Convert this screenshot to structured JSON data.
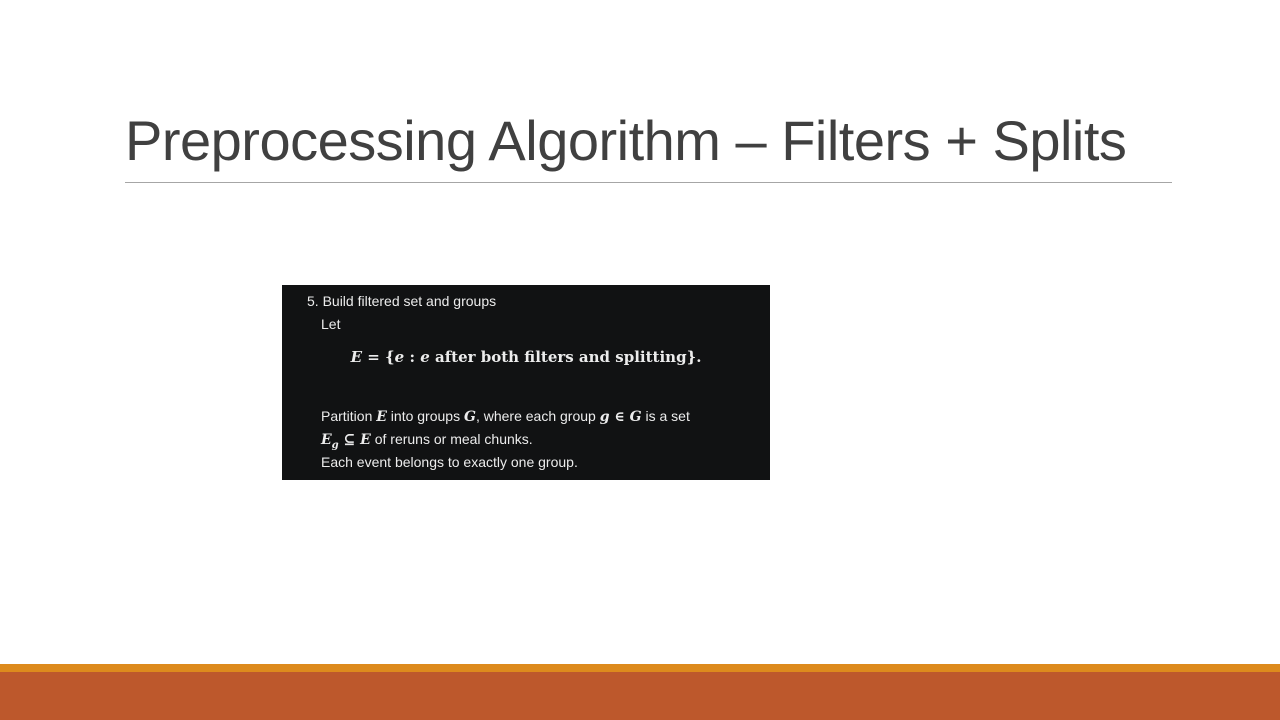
{
  "slide": {
    "title": "Preprocessing Algorithm – Filters + Splits"
  },
  "content": {
    "step_heading": "5. Build filtered set and groups",
    "let_label": "Let",
    "equation": {
      "lhs": "E",
      "equals": " = {",
      "var": "e",
      "colon": " : ",
      "var2": "e",
      "text": " after both filters and splitting",
      "close": "}."
    },
    "partition_line": {
      "pre": "Partition ",
      "sym_e": "E",
      "mid1": " into groups ",
      "sym_g_set": "G",
      "mid2": ", where each group ",
      "sym_g": "g",
      "in": " ∈ ",
      "sym_g_set2": "G",
      "post": " is a set"
    },
    "subset_line": {
      "sym_e": "E",
      "sub": "g",
      "subseteq": " ⊆ ",
      "sym_e2": "E",
      "post": " of reruns or meal chunks."
    },
    "each_line": "Each event belongs to exactly one group."
  },
  "colors": {
    "accent_orange": "#dd8a1d",
    "footer_rust": "#bd582c",
    "title_text": "#404040",
    "panel_bg": "#111213"
  }
}
